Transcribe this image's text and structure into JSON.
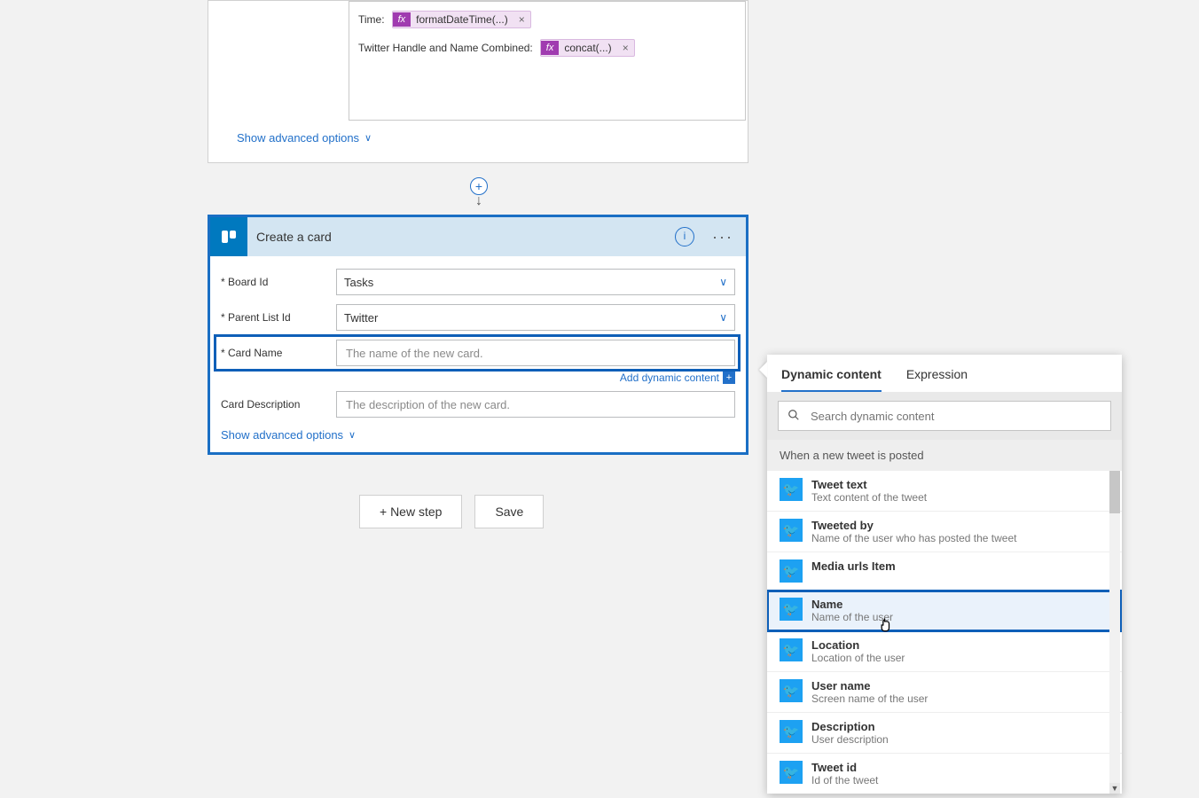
{
  "topCard": {
    "timeLabel": "Time:",
    "combinedLabel": "Twitter Handle and Name Combined:",
    "fxBadge": "fx",
    "formatChip": "formatDateTime(...)",
    "concatChip": "concat(...)",
    "chipClose": "×",
    "advOptions": "Show advanced options"
  },
  "card": {
    "title": "Create a card",
    "fields": {
      "boardId": {
        "label": "Board Id",
        "value": "Tasks"
      },
      "parentListId": {
        "label": "Parent List Id",
        "value": "Twitter"
      },
      "cardName": {
        "label": "Card Name",
        "placeholder": "The name of the new card."
      },
      "cardDesc": {
        "label": "Card Description",
        "placeholder": "The description of the new card."
      }
    },
    "requiredMark": "*",
    "addDynamic": "Add dynamic content",
    "advOptions": "Show advanced options"
  },
  "buttons": {
    "newStep": "+ New step",
    "save": "Save"
  },
  "popup": {
    "tabs": {
      "dynamic": "Dynamic content",
      "expression": "Expression"
    },
    "searchPlaceholder": "Search dynamic content",
    "sectionTitle": "When a new tweet is posted",
    "items": [
      {
        "title": "Tweet text",
        "desc": "Text content of the tweet"
      },
      {
        "title": "Tweeted by",
        "desc": "Name of the user who has posted the tweet"
      },
      {
        "title": "Media urls Item",
        "desc": ""
      },
      {
        "title": "Name",
        "desc": "Name of the user"
      },
      {
        "title": "Location",
        "desc": "Location of the user"
      },
      {
        "title": "User name",
        "desc": "Screen name of the user"
      },
      {
        "title": "Description",
        "desc": "User description"
      },
      {
        "title": "Tweet id",
        "desc": "Id of the tweet"
      }
    ]
  }
}
